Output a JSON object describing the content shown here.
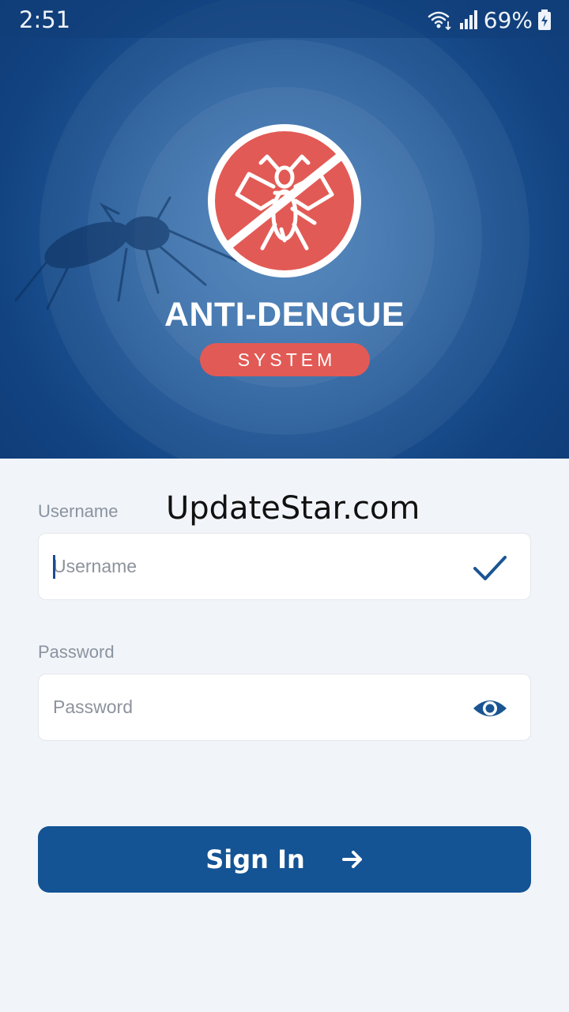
{
  "status_bar": {
    "time": "2:51",
    "battery": "69%",
    "icons": [
      "wifi-icon",
      "signal-icon",
      "battery-icon"
    ]
  },
  "brand": {
    "title": "ANTI-DENGUE",
    "subtitle": "SYSTEM",
    "logo_icon": "no-mosquito-icon",
    "accent_color": "#e25a55",
    "primary_color": "#145394"
  },
  "watermark": "UpdateStar.com",
  "form": {
    "username": {
      "label": "Username",
      "placeholder": "Username",
      "value": "",
      "icon": "checkmark-icon"
    },
    "password": {
      "label": "Password",
      "placeholder": "Password",
      "value": "",
      "icon": "eye-icon"
    },
    "submit": {
      "label": "Sign In",
      "icon": "arrow-right-icon"
    }
  }
}
